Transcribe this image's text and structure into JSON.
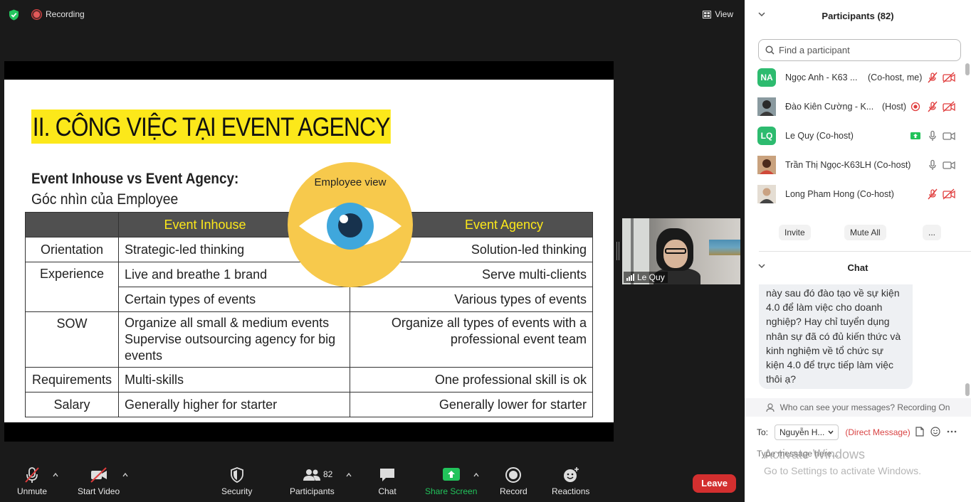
{
  "topbar": {
    "recording_label": "Recording",
    "view_label": "View"
  },
  "slide": {
    "title": "II. CÔNG VIỆC TẠI EVENT AGENCY",
    "subtitle_bold": "Event Inhouse vs Event Agency:",
    "subtitle": "Góc nhìn của Employee",
    "eye_label": "Employee view",
    "table": {
      "headers": [
        "",
        "Event Inhouse",
        "Event Agency"
      ],
      "rows": [
        {
          "label": "Orientation",
          "inhouse": "Strategic-led thinking",
          "agency": "Solution-led thinking"
        },
        {
          "label": "Experience",
          "inhouse": "Live and breathe 1 brand",
          "agency": "Serve multi-clients"
        },
        {
          "label": "",
          "inhouse": "Certain types of events",
          "agency": "Various types of events"
        },
        {
          "label": "SOW",
          "inhouse_lines": [
            "Organize all small & medium events",
            "Supervise outsourcing agency for big",
            "events"
          ],
          "agency_lines": [
            "Organize all types of events with a",
            "professional event team"
          ]
        },
        {
          "label": "Requirements",
          "inhouse": "Multi-skills",
          "agency": "One professional skill is ok"
        },
        {
          "label": "Salary",
          "inhouse": "Generally higher for starter",
          "agency": "Generally lower for starter"
        }
      ]
    }
  },
  "video_tile": {
    "name": "Le Quy"
  },
  "toolbar": {
    "unmute": "Unmute",
    "start_video": "Start Video",
    "security": "Security",
    "participants": "Participants",
    "participants_count": "82",
    "chat": "Chat",
    "share_screen": "Share Screen",
    "record": "Record",
    "reactions": "Reactions",
    "leave": "Leave"
  },
  "participants_panel": {
    "title": "Participants (82)",
    "search_placeholder": "Find a participant",
    "participants": [
      {
        "initials": "NA",
        "name": "Ngọc Anh - K63 ...",
        "role": "(Co-host, me)",
        "avatar_color": "#2dbb6f"
      },
      {
        "initials": "",
        "name": "Đào Kiên Cường - K...",
        "role": "(Host)",
        "avatar_color": "#6e7b7a"
      },
      {
        "initials": "LQ",
        "name": "Le Quy (Co-host)",
        "role": "",
        "avatar_color": "#2dbb6f"
      },
      {
        "initials": "",
        "name": "Trần Thị Ngọc-K63LH (Co-host)",
        "role": "",
        "avatar_color": "#a4755a"
      },
      {
        "initials": "",
        "name": "Long Pham Hong (Co-host)",
        "role": "",
        "avatar_color": "#b9a48c"
      }
    ],
    "invite": "Invite",
    "mute_all": "Mute All",
    "more": "..."
  },
  "chat_panel": {
    "title": "Chat",
    "message_lines": [
      "này sau đó đào tạo về sự kiện",
      "4.0 để làm việc cho doanh",
      "nghiệp? Hay chỉ tuyển dụng",
      "nhân sự đã có đủ kiến thức và",
      "kinh nghiệm về tổ chức sự",
      "kiện 4.0 để trực tiếp làm việc",
      "thôi ạ?"
    ],
    "privacy_note": "Who can see your messages? Recording On",
    "to_label": "To:",
    "to_value": "Nguyễn H...",
    "direct_message": "(Direct Message)",
    "input_placeholder": "Type message here...",
    "watermark_title": "Activate Windows",
    "watermark_sub": "Go to Settings to activate Windows."
  }
}
